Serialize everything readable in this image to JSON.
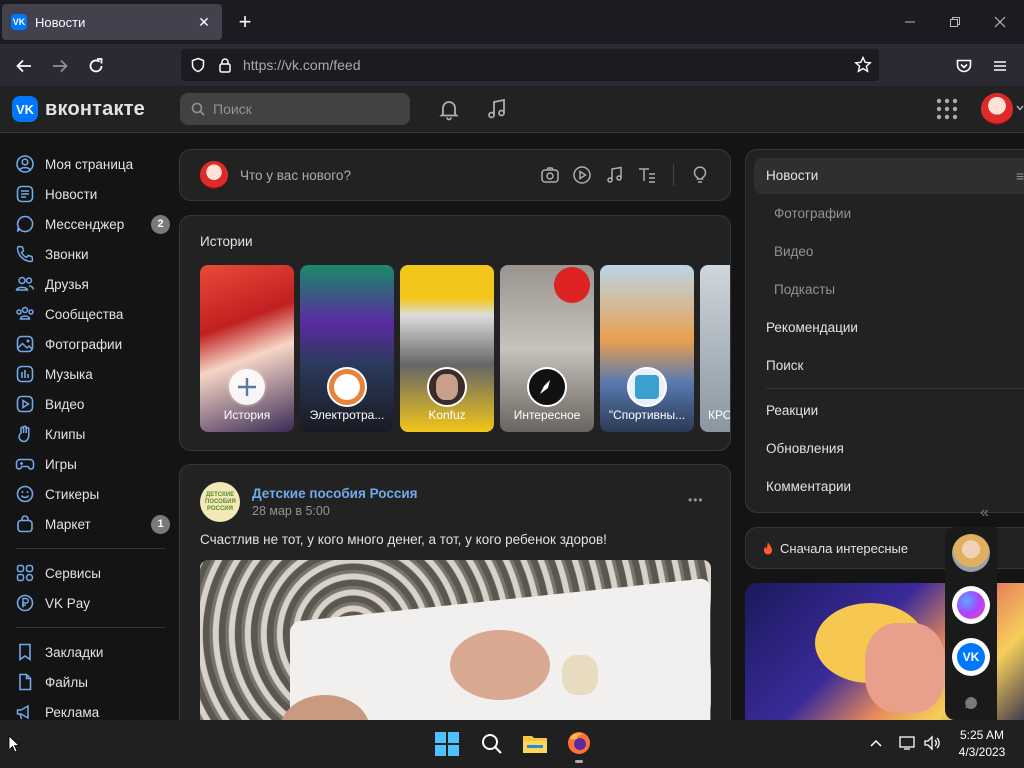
{
  "browser": {
    "tab_title": "Новости",
    "new_tab_label": "+",
    "url_host": "https://vk.com",
    "url_path": "/feed"
  },
  "header": {
    "logo_text": "вконтакте",
    "search_placeholder": "Поиск"
  },
  "sidebar": {
    "items": [
      {
        "label": "Моя страница",
        "icon": "user-circle-icon"
      },
      {
        "label": "Новости",
        "icon": "news-icon"
      },
      {
        "label": "Мессенджер",
        "icon": "message-icon",
        "count": "2"
      },
      {
        "label": "Звонки",
        "icon": "phone-icon"
      },
      {
        "label": "Друзья",
        "icon": "friends-icon"
      },
      {
        "label": "Сообщества",
        "icon": "communities-icon"
      },
      {
        "label": "Фотографии",
        "icon": "photo-icon"
      },
      {
        "label": "Музыка",
        "icon": "music-icon"
      },
      {
        "label": "Видео",
        "icon": "video-icon"
      },
      {
        "label": "Клипы",
        "icon": "clips-icon"
      },
      {
        "label": "Игры",
        "icon": "gamepad-icon"
      },
      {
        "label": "Стикеры",
        "icon": "sticker-icon"
      },
      {
        "label": "Маркет",
        "icon": "bag-icon",
        "count": "1"
      }
    ],
    "items2": [
      {
        "label": "Сервисы",
        "icon": "services-icon"
      },
      {
        "label": "VK Pay",
        "icon": "vkpay-icon"
      }
    ],
    "items3": [
      {
        "label": "Закладки",
        "icon": "bookmark-icon"
      },
      {
        "label": "Файлы",
        "icon": "file-icon"
      },
      {
        "label": "Реклама",
        "icon": "ads-icon"
      }
    ]
  },
  "composer": {
    "placeholder": "Что у вас нового?"
  },
  "stories": {
    "title": "Истории",
    "items": [
      {
        "label": "История"
      },
      {
        "label": "Электротра..."
      },
      {
        "label": "Konfuz"
      },
      {
        "label": "Интересное"
      },
      {
        "label": "\"Спортивны..."
      },
      {
        "label": "КРО"
      }
    ]
  },
  "post": {
    "author": "Детские пособия Россия",
    "date": "28 мар в 5:00",
    "text": "Счастлив не тот, у кого много денег, а тот, у кого ребенок здоров!",
    "more_label": "•••",
    "avatar_text": "ДЕТСКИЕ ПОСОБИЯ РОССИЯ"
  },
  "right_menu": {
    "news": "Новости",
    "photos": "Фотографии",
    "video": "Видео",
    "podcasts": "Подкасты",
    "recommendations": "Рекомендации",
    "search": "Поиск",
    "reactions": "Реакции",
    "updates": "Обновления",
    "comments": "Комментарии",
    "sort_label": "Сначала интересные"
  },
  "taskbar": {
    "time": "5:25 AM",
    "date": "4/3/2023"
  },
  "colors": {
    "vk_blue": "#0077ff",
    "link": "#71aaeb",
    "bg": "#141414",
    "card": "#222222"
  }
}
